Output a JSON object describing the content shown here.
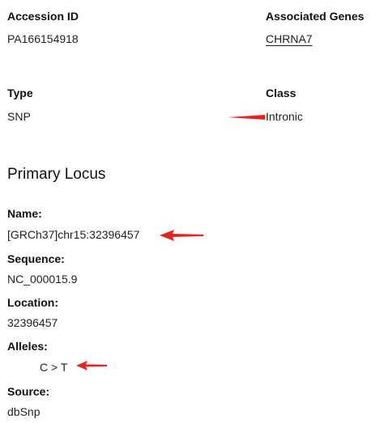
{
  "summary": {
    "accession_id": {
      "label": "Accession ID",
      "value": "PA166154918"
    },
    "associated_genes": {
      "label": "Associated Genes",
      "value": "CHRNA7"
    },
    "type": {
      "label": "Type",
      "value": "SNP"
    },
    "class": {
      "label": "Class",
      "value": "Intronic"
    }
  },
  "primary_locus": {
    "heading": "Primary Locus",
    "name": {
      "label": "Name:",
      "value": "[GRCh37]chr15:32396457"
    },
    "sequence": {
      "label": "Sequence:",
      "value": "NC_000015.9"
    },
    "location": {
      "label": "Location:",
      "value": "32396457"
    },
    "alleles": {
      "label": "Alleles:",
      "value": "C > T"
    },
    "source": {
      "label": "Source:",
      "value": "dbSnp"
    }
  },
  "colors": {
    "text": "#1f1f1f",
    "label": "#111111",
    "annotation_arrow": "#e8231f"
  },
  "annotations": [
    {
      "icon": "red-arrow-icon",
      "points_to": "class"
    },
    {
      "icon": "red-arrow-icon",
      "points_to": "name"
    },
    {
      "icon": "red-arrow-icon",
      "points_to": "alleles"
    }
  ]
}
